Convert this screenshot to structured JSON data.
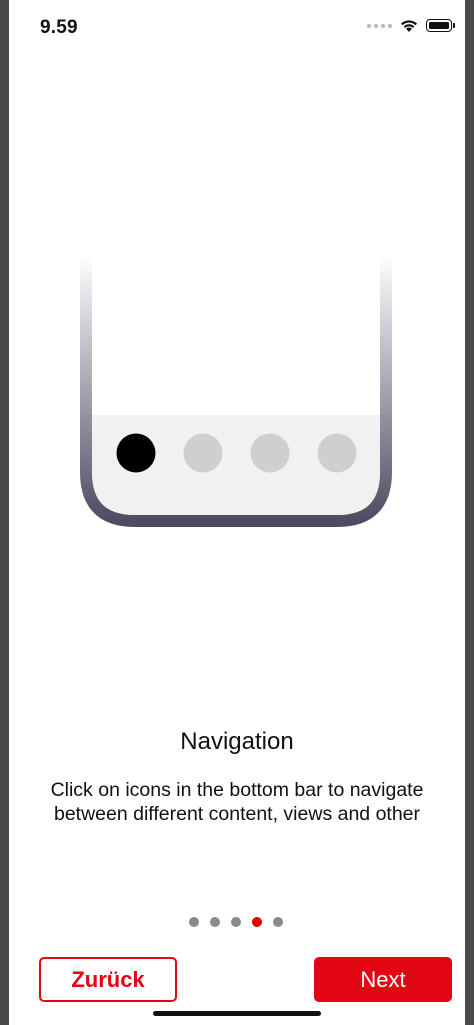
{
  "status_bar": {
    "time": "9.59",
    "signal_icon": "cellular-signal-icon",
    "wifi_icon": "wifi-icon",
    "battery_icon": "battery-icon"
  },
  "illustration": {
    "icon": "phone-bottom-bar-illustration",
    "active_tab_index": 0,
    "tab_count": 4,
    "colors": {
      "frame": "#4f4b62",
      "bar": "#f1f1f1",
      "active_tab": "#000000",
      "inactive_tab": "#cfcfcf"
    }
  },
  "content": {
    "title": "Navigation",
    "description": "Click on icons in the bottom bar to navigate between different content, views and other"
  },
  "pager": {
    "total": 5,
    "current": 4,
    "active_color": "#e00000",
    "inactive_color": "#8a8a8a"
  },
  "buttons": {
    "back_label": "Zurück",
    "next_label": "Next",
    "accent_color": "#e30613"
  }
}
